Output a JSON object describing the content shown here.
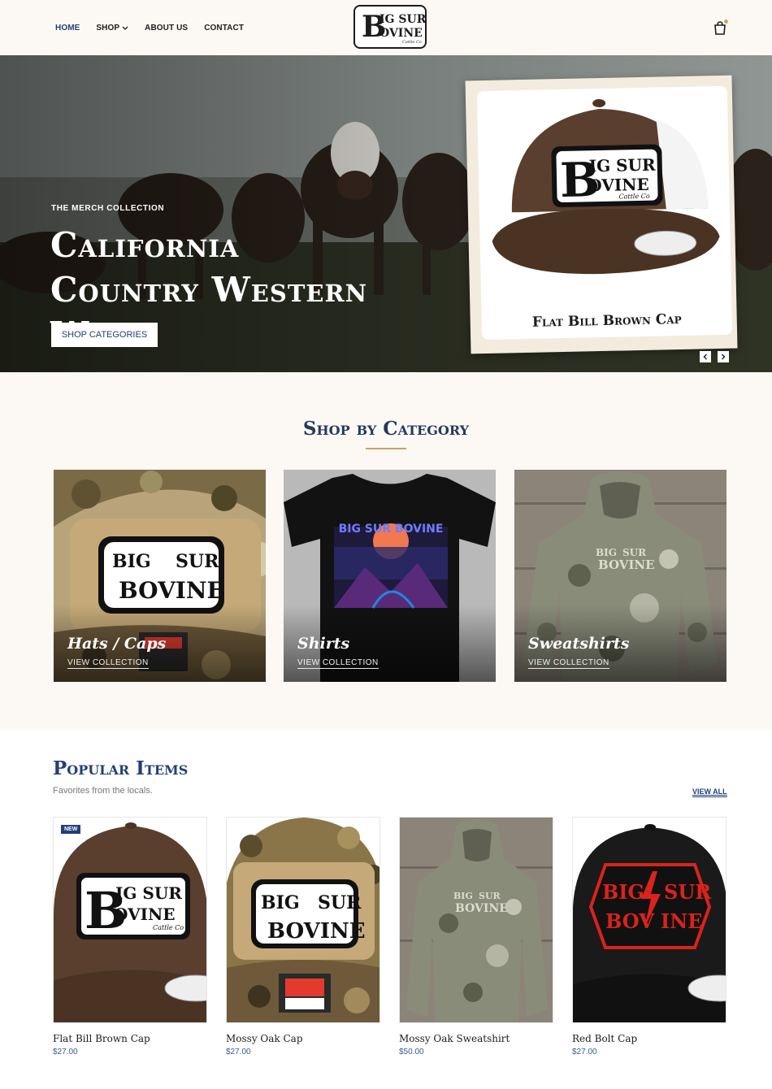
{
  "header": {
    "nav": [
      {
        "label": "HOME",
        "active": true
      },
      {
        "label": "SHOP",
        "has_dropdown": true
      },
      {
        "label": "ABOUT US"
      },
      {
        "label": "CONTACT"
      }
    ],
    "logo_lines": [
      "BIG SUR",
      "BOVINE",
      "Cattle Co"
    ],
    "cart_icon": "shopping-bag-icon"
  },
  "hero": {
    "eyebrow": "THE MERCH COLLECTION",
    "title": "California Country Western Wear",
    "button": "SHOP CATEGORIES",
    "feature_caption": "Flat Bill Brown Cap",
    "feature_patch": [
      "BIG SUR",
      "BOVINE",
      "Cattle Co"
    ],
    "prev_icon": "chevron-left-icon",
    "next_icon": "chevron-right-icon"
  },
  "categories": {
    "title": "Shop by Category",
    "items": [
      {
        "name": "Hats / Caps",
        "link": "VIEW COLLECTION"
      },
      {
        "name": "Shirts",
        "link": "VIEW COLLECTION",
        "print": "BIG SUR BOVINE"
      },
      {
        "name": "Sweatshirts",
        "link": "VIEW COLLECTION"
      }
    ]
  },
  "popular": {
    "title": "Popular Items",
    "subtitle": "Favorites from the locals.",
    "view_all": "VIEW ALL",
    "products": [
      {
        "name": "Flat Bill Brown Cap",
        "price": "$27.00",
        "badge": "NEW"
      },
      {
        "name": "Mossy Oak Cap",
        "price": "$27.00"
      },
      {
        "name": "Mossy Oak Sweatshirt",
        "price": "$50.00"
      },
      {
        "name": "Red Bolt Cap",
        "price": "$27.00"
      }
    ]
  },
  "colors": {
    "navy": "#233f78",
    "gold": "#c8a36a",
    "cream": "#fcf9f5"
  }
}
